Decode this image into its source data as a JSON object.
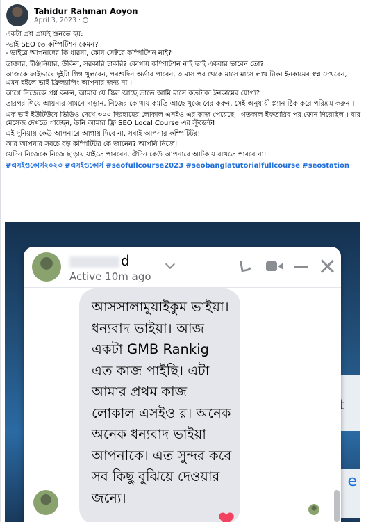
{
  "author": {
    "name": "Tahidur Rahman Aoyon",
    "date": "April 3, 2023",
    "separator": "·"
  },
  "post_paragraphs": [
    "একটা প্রশ্ন প্রায়ই শুনতে হয়:",
    "-ভাই SEO তে কম্পিটিশন কেমন?\n- ভাইরে আপনাদের কি ধারনা, কোন সেক্টরে কম্পিটিশন নাই?",
    "ডাক্তার, ইঞ্জিনিয়ার, উকিল, সরকারি চাকরি? কোথায় কম্পিটিশন নাই ভাই একবার ভাবেন তো?",
    "আজকে ফাইভারে দুইটা গিগ খুলবেন, পরশুদিন অর্ডার পাবেন, ৩ মাস পর থেকে মাসে মাসে লাখ টাকা ইনকামের স্বপ্ন দেখবেন, এমন হইলে ভাই ফ্রিল্যান্সিং আপনার জন্য না ।",
    "আগে নিজেকে প্রশ্ন করুন, আমার যে স্কিল আছে তাতে আমি মাসে কতটাকা ইনকামের যোগ্য?",
    "তারপর গিয়ে আয়নার সামনে দাড়ান, নিজের কোথায় কমতি আছে খুজে বের করুন, সেই অনুযায়ী প্ল্যান ঠিক করে পরিশ্রম করুন ।",
    "এক ভাই ইউটিউবে ভিডিও দেখে ৩০০ দিরহামের লোকাল এসইও এর কাজ পেয়েছে । গতকাল ইফতারির পর ফোন দিয়েছিল । যার মেসেজ দেখতে পাচ্ছেন, উনি আমার ফ্রি SEO Local Course এর স্টুডেন্ট!",
    "এই দুনিয়ায় কেউ আপনারে আগায় দিবে না, সবাই আপনার কম্পিটিটর!",
    "আর আপনার সবচে বড় কম্পিটিটর কে জানেন? আপনি নিজে!",
    "যেদিন নিজেকে নিজে ছাড়ায় যাইতে পারবেন, ঐদিন কেউ আপনারে আটকায় রাখতে পারবে না!"
  ],
  "hashtags": "#এসইওকোর্স২০২৩ #এসইওকোর্স #seofullcourse2023 #seobanglatutorialfullcourse #seostation",
  "chat": {
    "name_suffix": "d",
    "status": "Active 10m ago",
    "message": "আসসালামুয়াইকুম ভাইয়া।ধন্যবাদ ভাইয়া। আজ একটা GMB Rankig এত কাজ পাইছি। এটা আমার প্রথম কাজ লোকাল এসইও র। অনেক অনেক ধন্যবাদ ভাইয়া আপনাকে। এত সুন্দর করে সব কিছু বুঝিয়ে দেওয়ার জন্যে।",
    "header_icons": [
      "phone-icon",
      "video-camera-icon",
      "minimize-icon",
      "close-icon"
    ]
  },
  "background": {
    "side_letter_1": "t",
    "side_letter_2": "e"
  },
  "colors": {
    "hashtag": "#216fdb",
    "bubble": "#e4e6eb",
    "heart": "#f3425f"
  }
}
